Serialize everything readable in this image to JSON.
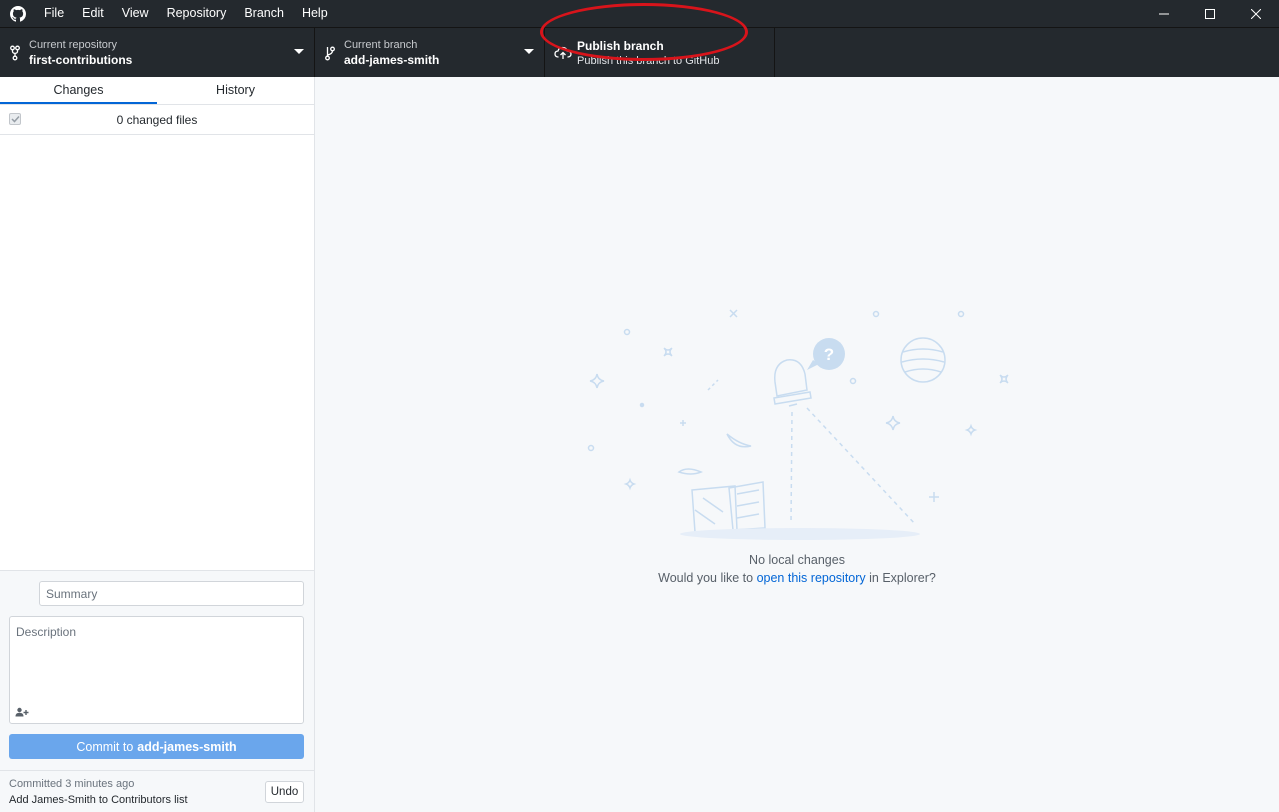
{
  "titlebar": {
    "menus": [
      "File",
      "Edit",
      "View",
      "Repository",
      "Branch",
      "Help"
    ]
  },
  "toolbar": {
    "repository": {
      "label": "Current repository",
      "value": "first-contributions"
    },
    "branch": {
      "label": "Current branch",
      "value": "add-james-smith"
    },
    "publish": {
      "label": "Publish branch",
      "description": "Publish this branch to GitHub"
    }
  },
  "sidebar": {
    "tabs": [
      {
        "label": "Changes",
        "active": true
      },
      {
        "label": "History",
        "active": false
      }
    ],
    "changes_count": "0 changed files",
    "summary_placeholder": "Summary",
    "description_placeholder": "Description",
    "commit_button": {
      "prefix": "Commit to",
      "branch": "add-james-smith"
    },
    "last_commit": {
      "time": "Committed 3 minutes ago",
      "message": "Add James-Smith to Contributors list",
      "undo_label": "Undo"
    }
  },
  "main": {
    "blank_title": "No local changes",
    "blank_prefix": "Would you like to ",
    "blank_link": "open this repository",
    "blank_suffix": " in Explorer?"
  },
  "colors": {
    "chrome": "#24292e",
    "accent": "#0366d6",
    "commit_button": "#6aa6ec",
    "annotation_ring": "#d8141b"
  }
}
